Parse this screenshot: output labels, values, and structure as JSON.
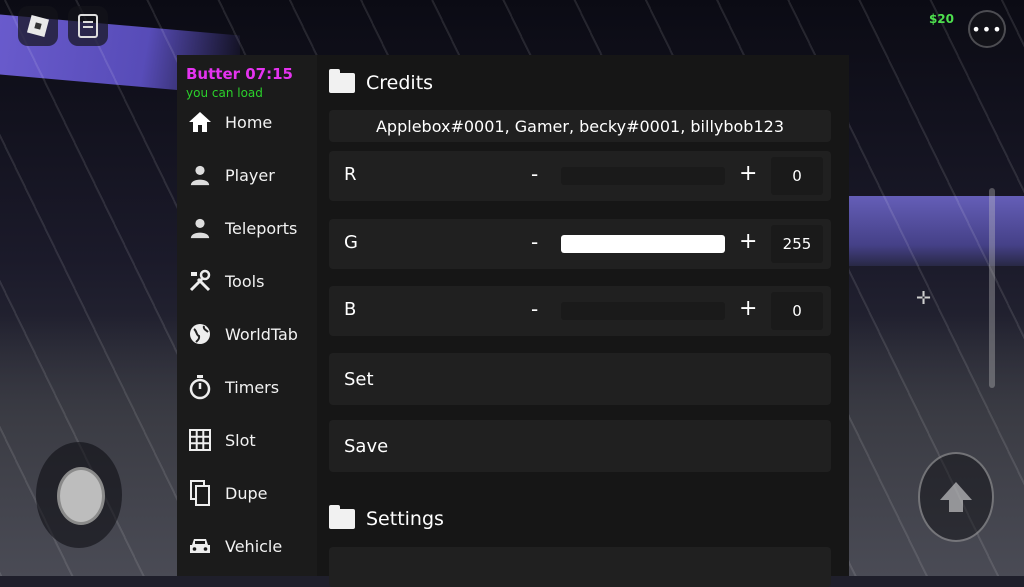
{
  "topbar": {
    "money": "$20",
    "menu_icon": "ellipsis-icon"
  },
  "gui": {
    "brand": "Butter 07:15",
    "brand_sub": "you can load",
    "brand_colors": {
      "title": "#e533f0",
      "sub": "#2bd12b"
    },
    "nav": [
      {
        "label": "Home",
        "icon": "home-icon"
      },
      {
        "label": "Player",
        "icon": "person-icon"
      },
      {
        "label": "Teleports",
        "icon": "person-icon"
      },
      {
        "label": "Tools",
        "icon": "tools-icon"
      },
      {
        "label": "WorldTab",
        "icon": "globe-icon"
      },
      {
        "label": "Timers",
        "icon": "timer-icon"
      },
      {
        "label": "Slot",
        "icon": "grid-icon"
      },
      {
        "label": "Dupe",
        "icon": "copy-icon"
      },
      {
        "label": "Vehicle",
        "icon": "car-icon"
      }
    ],
    "credits": {
      "title": "Credits",
      "text": "Applebox#0001, Gamer, becky#0001, billybob123"
    },
    "color_rows": [
      {
        "label": "R",
        "minus": "-",
        "plus": "+",
        "value": "0",
        "level": 0
      },
      {
        "label": "G",
        "minus": "-",
        "plus": "+",
        "value": "255",
        "level": 1
      },
      {
        "label": "B",
        "minus": "-",
        "plus": "+",
        "value": "0",
        "level": 0
      }
    ],
    "set_label": "Set",
    "save_label": "Save",
    "settings": {
      "title": "Settings"
    }
  }
}
